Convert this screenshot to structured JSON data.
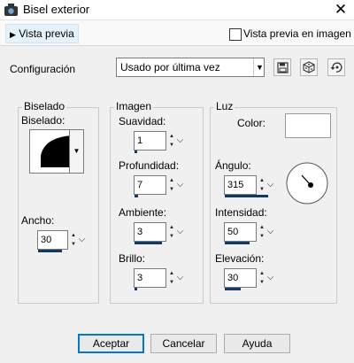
{
  "window": {
    "title": "Bisel exterior",
    "close_glyph": "✕"
  },
  "preview": {
    "toggle_label": "Vista previa",
    "image_checkbox_label": "Vista previa en imagen",
    "image_checked": false
  },
  "config": {
    "label": "Configuración",
    "preset_value": "Usado por última vez",
    "icons": [
      "save-preset-icon",
      "randomize-icon",
      "reset-icon"
    ]
  },
  "bevel": {
    "group_label": "Biselado",
    "shape_label": "Biselado:",
    "width_label": "Ancho:",
    "width_value": "30",
    "width_fraction": 0.5
  },
  "image": {
    "group_label": "Imagen",
    "fields": [
      {
        "label": "Suavidad:",
        "value": "1",
        "fraction": 0.05
      },
      {
        "label": "Profundidad:",
        "value": "7",
        "fraction": 0.07
      },
      {
        "label": "Ambiente:",
        "value": "3",
        "fraction": 0.55
      },
      {
        "label": "Brillo:",
        "value": "3",
        "fraction": 0.05
      }
    ]
  },
  "light": {
    "group_label": "Luz",
    "color_label": "Color:",
    "color_value": "#ffffff",
    "fields": [
      {
        "label": "Ángulo:",
        "value": "315",
        "fraction": 0.87
      },
      {
        "label": "Intensidad:",
        "value": "50",
        "fraction": 0.5
      },
      {
        "label": "Elevación:",
        "value": "30",
        "fraction": 0.33
      }
    ]
  },
  "buttons": {
    "accept": "Aceptar",
    "cancel": "Cancelar",
    "help": "Ayuda"
  },
  "colors": {
    "accent_bar": "#0f3a66",
    "default_button_border": "#0078d7"
  }
}
